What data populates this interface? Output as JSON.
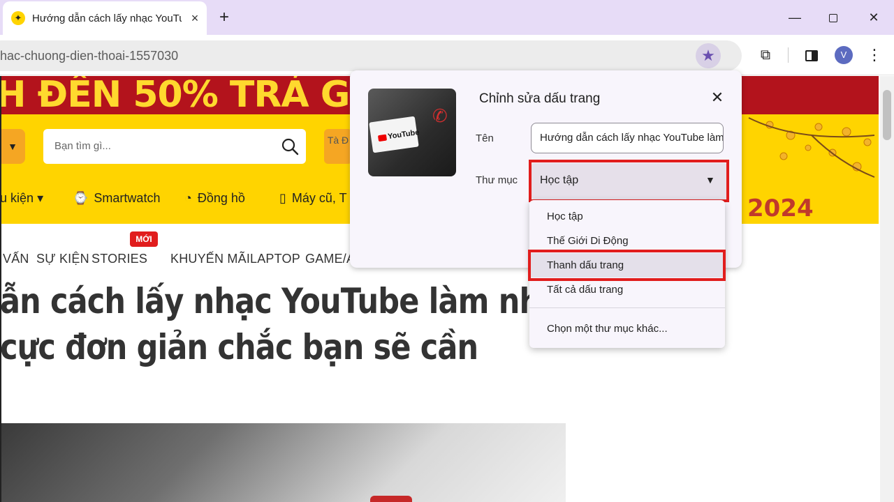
{
  "browser": {
    "tab": {
      "title": "Hướng dẫn cách lấy nhạc YouTube",
      "close_icon": "×"
    },
    "new_tab_icon": "+",
    "window": {
      "minimize": "—",
      "close": "✕"
    },
    "url": "hac-chuong-dien-thoai-1557030",
    "star_icon": "★",
    "extensions_icon": "⧉",
    "profile_initial": "V",
    "menu_icon": "⋮",
    "accent": "#6a4fb0",
    "tabstrip_color": "#e7dcf7"
  },
  "page": {
    "banner": {
      "text_left": "H ĐẾN ",
      "big": "50%",
      "text_right": " TRẢ GÓ"
    },
    "search": {
      "placeholder": "Bạn tìm gì..."
    },
    "promo_button": "Tà Đ",
    "year_badge": "2024",
    "nav": [
      {
        "label": "u kiện",
        "icon": "▾"
      },
      {
        "label": "Smartwatch",
        "icon": "⌚"
      },
      {
        "label": "Đồng hồ",
        "icon": "◔"
      },
      {
        "label": "Máy cũ, T",
        "icon": "▯"
      }
    ],
    "categories": [
      "VẤN",
      "SỰ KIỆN",
      "STORIES",
      "KHUYẾN MÃI",
      "LAPTOP",
      "GAME/A"
    ],
    "new_badge": "MỚI",
    "article_title": {
      "line1": "ẫn cách lấy nhạc YouTube làm nhạ",
      "line2": "cực đơn giản chắc bạn sẽ cần"
    }
  },
  "bookmark_dialog": {
    "title": "Chỉnh sửa dấu trang",
    "close_icon": "✕",
    "thumb_brand": "YouTube",
    "name_label": "Tên",
    "name_value": "Hướng dẫn cách lấy nhạc YouTube làm",
    "folder_label": "Thư mục",
    "folder_value": "Học tập",
    "dropdown_icon": "▼",
    "options": [
      "Học tập",
      "Thế Giới Di Động",
      "Thanh dấu trang",
      "Tất cả dấu trang"
    ],
    "other_folder": "Chọn một thư mục khác...",
    "highlight_color": "#e11d1d"
  }
}
